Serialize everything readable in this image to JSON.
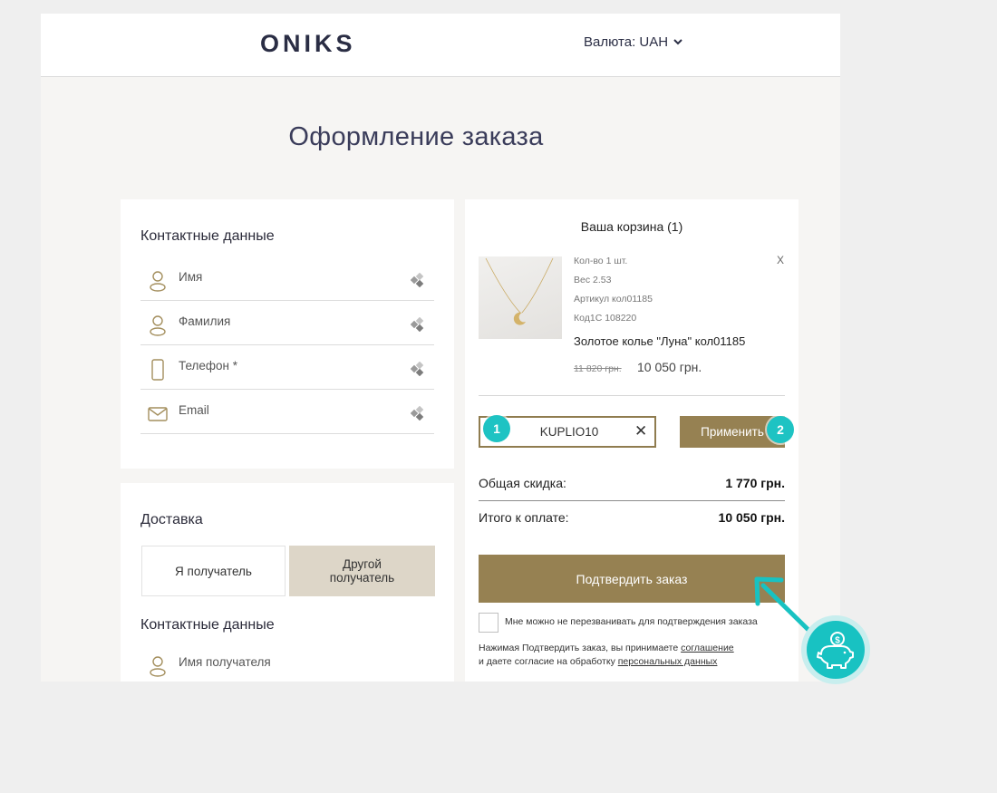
{
  "header": {
    "logo": "ONIKS",
    "currency_label": "Валюта:",
    "currency_value": "UAH"
  },
  "page_title": "Оформление заказа",
  "contacts": {
    "heading": "Контактные данные",
    "fields": [
      {
        "label": "Имя",
        "icon": "user-icon"
      },
      {
        "label": "Фамилия",
        "icon": "user-icon"
      },
      {
        "label": "Телефон *",
        "icon": "phone-icon"
      },
      {
        "label": "Email",
        "icon": "mail-icon"
      }
    ]
  },
  "delivery": {
    "heading": "Доставка",
    "option_me": "Я получатель",
    "option_other": "Другой получатель",
    "recipient_heading": "Контактные данные",
    "recipient_name_label": "Имя получателя"
  },
  "cart": {
    "heading": "Ваша корзина (1)",
    "item": {
      "qty": "Кол-во 1 шт.",
      "weight": "Вес 2.53",
      "article": "Артикул кол01185",
      "code": "Код1С 108220",
      "name": "Золотое колье \"Луна\" кол01185",
      "old_price": "11 820 грн.",
      "price": "10 050 грн.",
      "remove": "X"
    },
    "promo_code": "KUPLIO10",
    "promo_clear": "✕",
    "apply_label": "Применить",
    "discount_label": "Общая скидка:",
    "discount_value": "1 770 грн.",
    "total_label": "Итого к оплате:",
    "total_value": "10 050 грн.",
    "confirm_label": "Подтвердить заказ",
    "no_call_label": "Мне можно не перезванивать для подтверждения заказа",
    "consent_text_1": "Нажимая Подтвердить заказ, вы принимаете ",
    "consent_link_1": "соглашение",
    "consent_text_2": "и даете согласие на обработку ",
    "consent_link_2": "персональных данных"
  },
  "annotations": {
    "badge_1": "1",
    "badge_2": "2",
    "accent_color": "#1ec3c3",
    "piggy_symbol": "$"
  },
  "colors": {
    "brand_button": "#968152",
    "selected_toggle": "#ddd6c8",
    "title_color": "#3a3c5a"
  }
}
